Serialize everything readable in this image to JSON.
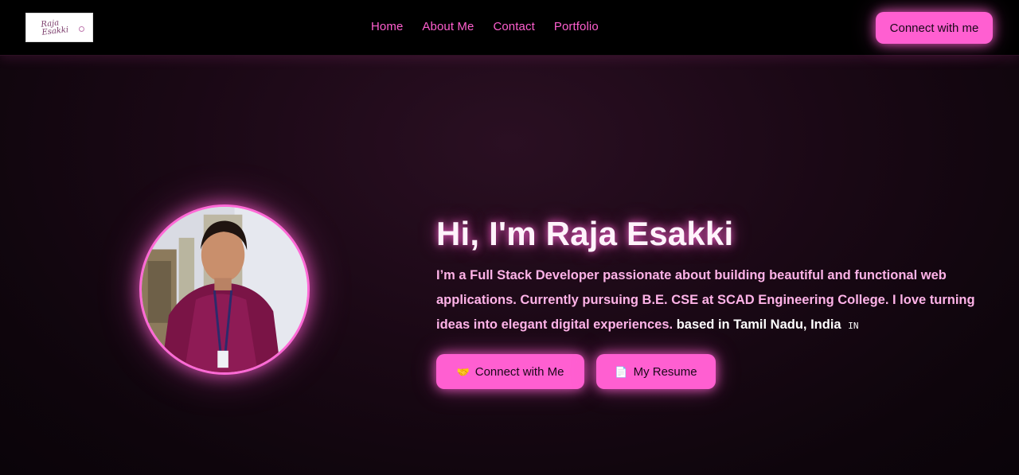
{
  "navbar": {
    "logo_text": "Raja\nEsakki",
    "links": [
      {
        "label": "Home"
      },
      {
        "label": "About Me"
      },
      {
        "label": "Contact"
      },
      {
        "label": "Portfolio"
      }
    ],
    "cta_label": "Connect with me"
  },
  "hero": {
    "title": "Hi, I'm Raja Esakki",
    "description": "I’m a Full Stack Developer passionate about building beautiful and functional web applications. Currently pursuing B.E. CSE at SCAD Engineering College. I love turning ideas into elegant digital experiences.",
    "location": "based in Tamil Nadu, India",
    "flag": "IN",
    "buttons": {
      "connect": {
        "icon": "🤝",
        "label": "Connect with Me"
      },
      "resume": {
        "icon": "📄",
        "label": "My Resume"
      }
    }
  },
  "icons": {
    "connect_button_icon": "handshake-icon",
    "resume_button_icon": "document-icon"
  },
  "colors": {
    "accent": "#ff5fd1",
    "nav_link": "#ff5fcf",
    "description": "#ffb3e8",
    "background": "#1a0815",
    "navbar": "#000000"
  }
}
